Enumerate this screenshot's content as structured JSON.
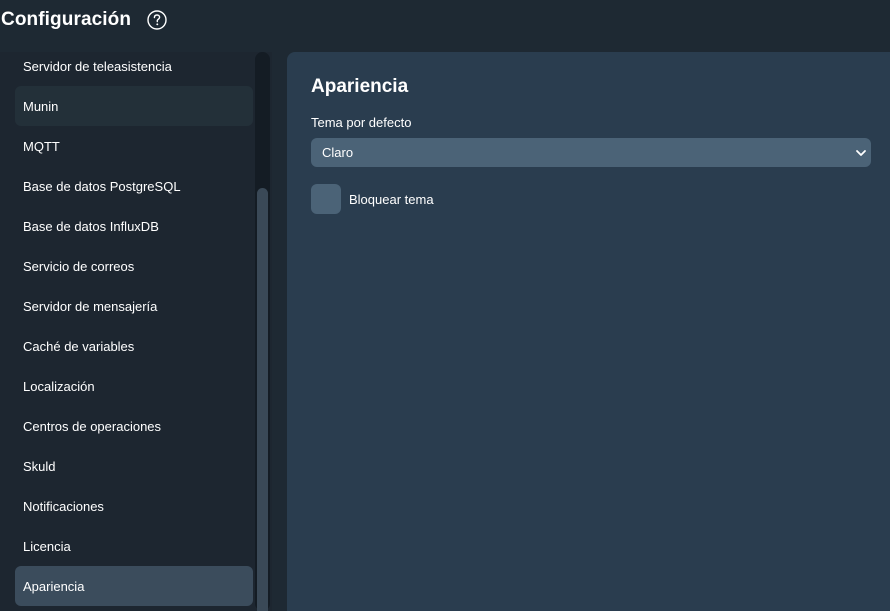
{
  "header": {
    "title": "Configuración",
    "help_icon": "help-circle-icon"
  },
  "sidebar": {
    "items": [
      {
        "label": "Servidor de teleasistencia",
        "state": "normal"
      },
      {
        "label": "Munin",
        "state": "hover"
      },
      {
        "label": "MQTT",
        "state": "normal"
      },
      {
        "label": "Base de datos PostgreSQL",
        "state": "normal"
      },
      {
        "label": "Base de datos InfluxDB",
        "state": "normal"
      },
      {
        "label": "Servicio de correos",
        "state": "normal"
      },
      {
        "label": "Servidor de mensajería",
        "state": "normal"
      },
      {
        "label": "Caché de variables",
        "state": "normal"
      },
      {
        "label": "Localización",
        "state": "normal"
      },
      {
        "label": "Centros de operaciones",
        "state": "normal"
      },
      {
        "label": "Skuld",
        "state": "normal"
      },
      {
        "label": "Notificaciones",
        "state": "normal"
      },
      {
        "label": "Licencia",
        "state": "normal"
      },
      {
        "label": "Apariencia",
        "state": "active"
      }
    ]
  },
  "main": {
    "section_title": "Apariencia",
    "theme_field": {
      "label": "Tema por defecto",
      "selected_value": "Claro"
    },
    "lock_theme": {
      "label": "Bloquear tema",
      "checked": false
    }
  },
  "colors": {
    "background": "#1e2933",
    "sidebar": "#1d2630",
    "panel": "#2a3d4f",
    "input": "#4b6377",
    "active_item": "#3b4c5c",
    "text": "#ffffff"
  }
}
